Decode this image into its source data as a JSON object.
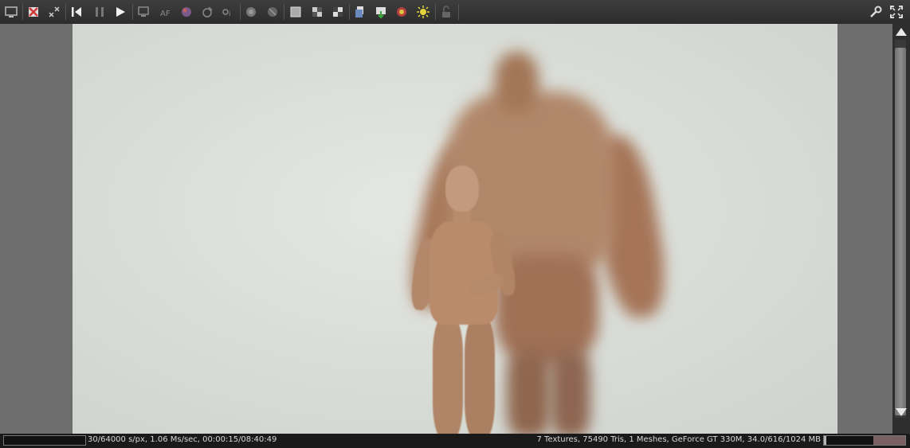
{
  "toolbar": {
    "buttons": [
      {
        "name": "display-icon"
      },
      {
        "name": "clear-cache-icon"
      },
      {
        "name": "resize-icon"
      },
      {
        "name": "restart-render-icon"
      },
      {
        "name": "pause-icon"
      },
      {
        "name": "play-icon"
      },
      {
        "name": "monitor-icon"
      },
      {
        "name": "af-icon"
      },
      {
        "name": "color-picker-icon"
      },
      {
        "name": "material-icon"
      },
      {
        "name": "info-focus-icon"
      },
      {
        "name": "object-icon"
      },
      {
        "name": "object-select-icon"
      },
      {
        "name": "checker-grid-icon"
      },
      {
        "name": "checker-alt-icon"
      },
      {
        "name": "checker-dark-icon"
      },
      {
        "name": "copy-icon"
      },
      {
        "name": "save-icon"
      },
      {
        "name": "camera-icon"
      },
      {
        "name": "light-icon"
      },
      {
        "name": "lock-icon"
      },
      {
        "name": "settings-wrench-icon"
      },
      {
        "name": "fullscreen-icon"
      }
    ]
  },
  "statusbar": {
    "left": "30/64000 s/px, 1.06 Ms/sec, 00:00:15/08:40:49",
    "right": "7 Textures, 75490 Tris, 1 Meshes, GeForce GT 330M, 34.0/616/1024 MB",
    "render_progress": 0.0,
    "memory_progress": 0.03
  },
  "colors": {
    "toolbar_bg": "#353535",
    "icon": "#cfcfcf",
    "accent_red": "#d23a3a",
    "accent_yellow": "#e6d23a"
  }
}
